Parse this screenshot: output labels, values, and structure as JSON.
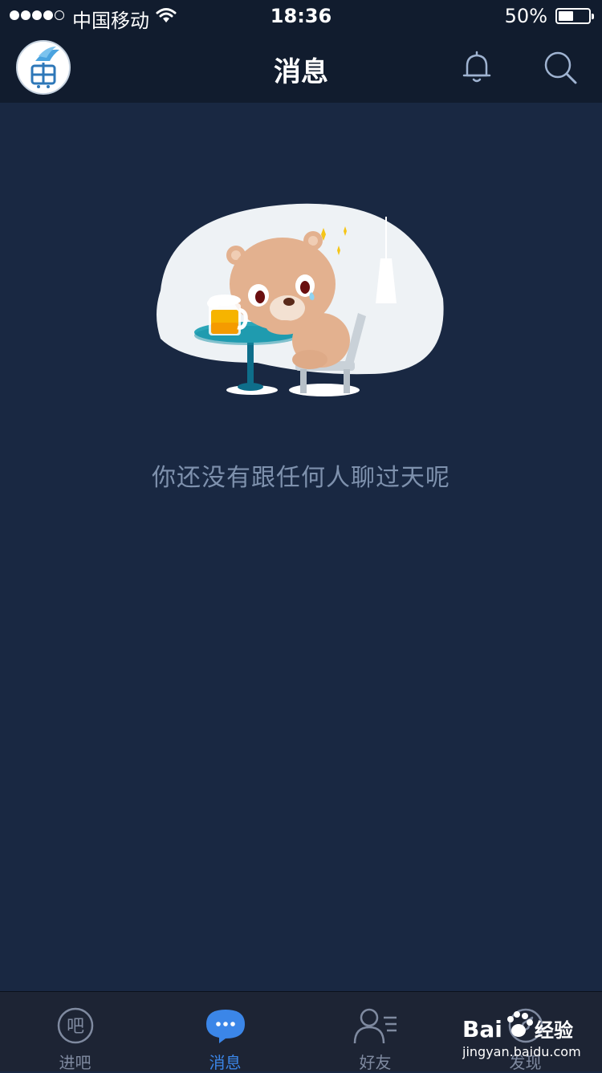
{
  "status_bar": {
    "carrier": "中国移动",
    "time": "18:36",
    "battery_percent": "50%",
    "battery_level": 0.5,
    "signal_bars_filled": 4,
    "signal_bars_total": 5
  },
  "header": {
    "title": "消息",
    "avatar_icon": "app-logo-avatar",
    "actions": [
      "bell-icon",
      "search-icon"
    ]
  },
  "empty_state": {
    "illustration": "bear-at-table-with-beer",
    "message": "你还没有跟任何人聊过天呢"
  },
  "tab_bar": {
    "active_index": 1,
    "tabs": [
      {
        "label": "进吧",
        "icon": "ba-circle-icon",
        "icon_text": "吧"
      },
      {
        "label": "消息",
        "icon": "chat-bubble-icon"
      },
      {
        "label": "好友",
        "icon": "friends-icon"
      },
      {
        "label": "发现",
        "icon": "discover-icon"
      }
    ]
  },
  "watermark": {
    "brand": "Bai",
    "brand_suffix": "经验",
    "url": "jingyan.baidu.com"
  },
  "colors": {
    "background": "#192842",
    "header": "#111c2e",
    "tab_active": "#3b86e8",
    "tab_inactive": "#7f8aa0",
    "empty_text": "#7e91ad"
  }
}
